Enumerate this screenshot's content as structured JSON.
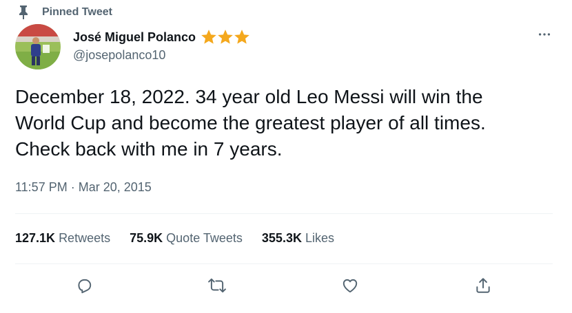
{
  "pinned": {
    "label": "Pinned Tweet"
  },
  "author": {
    "display_name": "José Miguel Polanco",
    "handle": "@josepolanco10",
    "badges": [
      "star",
      "star",
      "star"
    ],
    "badge_color": "#f4a81d"
  },
  "tweet": {
    "text": "December 18, 2022. 34 year old Leo Messi will win the\nWorld Cup and become the greatest player of all times.\nCheck back with me in 7 years.",
    "time": "11:57 PM",
    "separator": "·",
    "date": "Mar 20, 2015"
  },
  "stats": [
    {
      "count": "127.1K",
      "label": "Retweets"
    },
    {
      "count": "75.9K",
      "label": "Quote Tweets"
    },
    {
      "count": "355.3K",
      "label": "Likes"
    }
  ],
  "actions": [
    {
      "icon": "reply-icon"
    },
    {
      "icon": "retweet-icon"
    },
    {
      "icon": "like-icon"
    },
    {
      "icon": "share-icon"
    }
  ],
  "colors": {
    "text": "#0f1419",
    "secondary": "#536471",
    "divider": "#eff3f4"
  }
}
